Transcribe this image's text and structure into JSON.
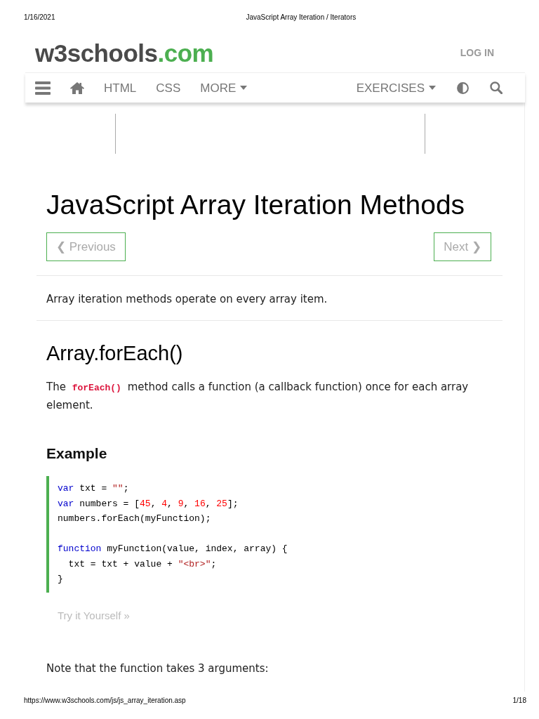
{
  "print_header": {
    "date": "1/16/2021",
    "title": "JavaScript Array Iteration / Iterators"
  },
  "site_header": {
    "logo": {
      "name": "w3schools",
      "suffix": ".com"
    },
    "login": "LOG IN"
  },
  "nav": {
    "left": [
      {
        "kind": "menu"
      },
      {
        "kind": "home"
      },
      {
        "kind": "link",
        "label": "HTML"
      },
      {
        "kind": "link",
        "label": "CSS"
      },
      {
        "kind": "dropdown",
        "label": "MORE"
      }
    ],
    "right": [
      {
        "kind": "dropdown",
        "label": "EXERCISES"
      },
      {
        "kind": "theme"
      },
      {
        "kind": "search"
      }
    ]
  },
  "page": {
    "title": "JavaScript Array Iteration Methods",
    "previous": "❮ Previous",
    "next": "Next ❯",
    "intro": "Array iteration methods operate on every array item.",
    "section": {
      "heading": "Array.forEach()",
      "description": [
        {
          "kind": "text",
          "text": "The"
        },
        {
          "kind": "code",
          "text": "forEach()"
        },
        {
          "kind": "text",
          "text": "method calls a function (a callback function) once for each array element."
        }
      ],
      "example": {
        "heading": "Example",
        "code": [
          {
            "lines": [
              {
                "tokens": [
                  {
                    "kind": "keyword",
                    "text": "var"
                  },
                  {
                    "kind": "plain",
                    "text": " txt = "
                  },
                  {
                    "kind": "string",
                    "text": "\"\""
                  },
                  {
                    "kind": "plain",
                    "text": ";"
                  }
                ]
              },
              {
                "tokens": [
                  {
                    "kind": "keyword",
                    "text": "var"
                  },
                  {
                    "kind": "plain",
                    "text": " numbers = ["
                  },
                  {
                    "kind": "number",
                    "text": "45"
                  },
                  {
                    "kind": "plain",
                    "text": ", "
                  },
                  {
                    "kind": "number",
                    "text": "4"
                  },
                  {
                    "kind": "plain",
                    "text": ", "
                  },
                  {
                    "kind": "number",
                    "text": "9"
                  },
                  {
                    "kind": "plain",
                    "text": ", "
                  },
                  {
                    "kind": "number",
                    "text": "16"
                  },
                  {
                    "kind": "plain",
                    "text": ", "
                  },
                  {
                    "kind": "number",
                    "text": "25"
                  },
                  {
                    "kind": "plain",
                    "text": "];"
                  }
                ]
              },
              {
                "tokens": [
                  {
                    "kind": "plain",
                    "text": "numbers.forEach(myFunction);"
                  }
                ]
              }
            ]
          },
          {
            "lines": [
              {
                "tokens": [
                  {
                    "kind": "keyword",
                    "text": "function"
                  },
                  {
                    "kind": "plain",
                    "text": " myFunction(value, index, array) {"
                  }
                ]
              },
              {
                "tokens": [
                  {
                    "kind": "plain",
                    "text": "  txt = txt + value + "
                  },
                  {
                    "kind": "string",
                    "text": "\"<br>\""
                  },
                  {
                    "kind": "plain",
                    "text": ";"
                  }
                ]
              },
              {
                "tokens": [
                  {
                    "kind": "plain",
                    "text": "}"
                  }
                ]
              }
            ]
          }
        ],
        "try_it": "Try it Yourself »"
      },
      "note": "Note that the function takes 3 arguments:"
    }
  },
  "print_footer": {
    "url": "https://www.w3schools.com/js/js_array_iteration.asp",
    "page": "1/18"
  }
}
